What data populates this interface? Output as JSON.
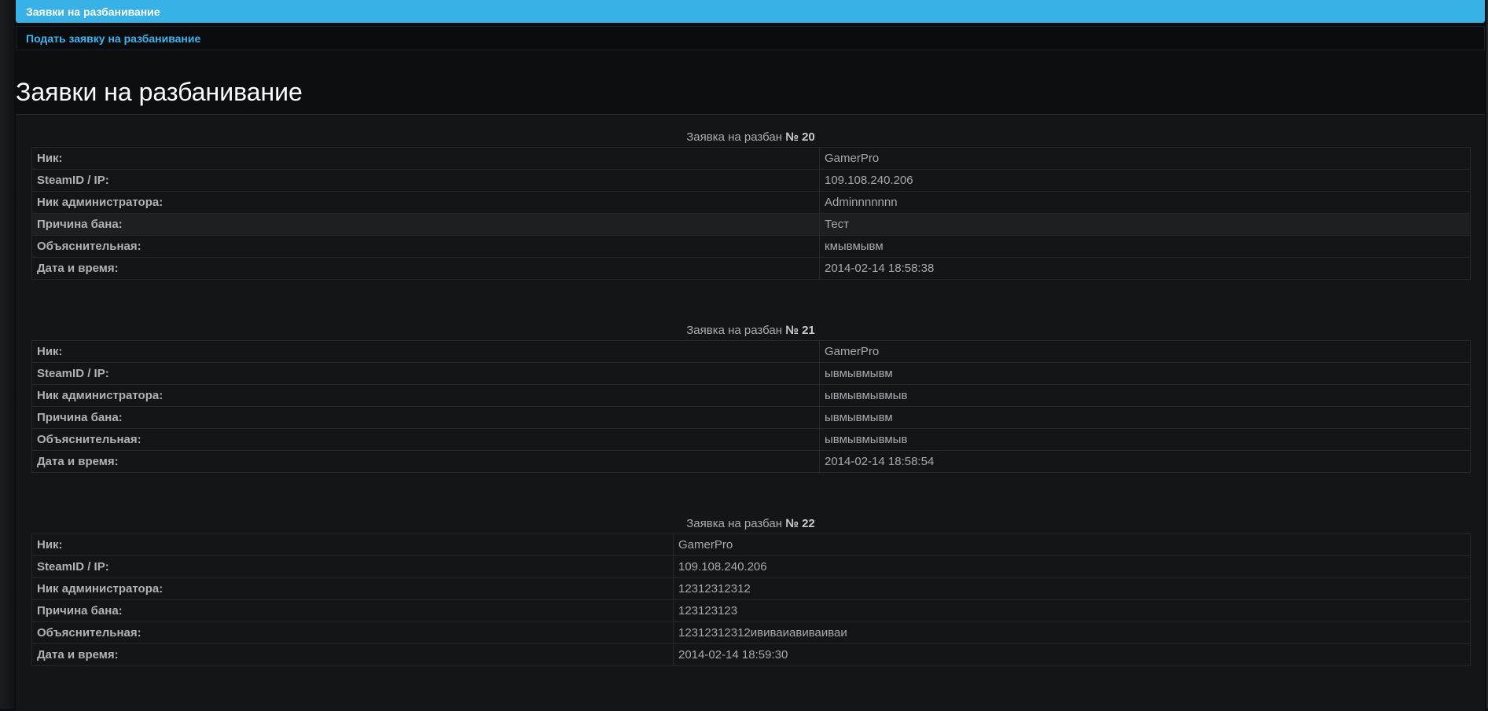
{
  "nav": {
    "active_label": "Заявки на разбанивание",
    "sub_label": "Подать заявку на разбанивание"
  },
  "page_title": "Заявки на разбанивание",
  "requests": [
    {
      "caption_prefix": "Заявка на разбан",
      "number": "№ 20",
      "rows": [
        {
          "label": "Ник:",
          "value": "GamerPro"
        },
        {
          "label": "SteamID / IP:",
          "value": "109.108.240.206"
        },
        {
          "label": "Ник администратора:",
          "value": "Adminnnnnnn"
        },
        {
          "label": "Причина бана:",
          "value": "Тест"
        },
        {
          "label": "Объяснительная:",
          "value": "кмывмывм"
        },
        {
          "label": "Дата и время:",
          "value": "2014-02-14 18:58:38"
        }
      ]
    },
    {
      "caption_prefix": "Заявка на разбан",
      "number": "№ 21",
      "rows": [
        {
          "label": "Ник:",
          "value": "GamerPro"
        },
        {
          "label": "SteamID / IP:",
          "value": "ывмывмывм"
        },
        {
          "label": "Ник администратора:",
          "value": "ывмывмывмыв"
        },
        {
          "label": "Причина бана:",
          "value": "ывмывмывм"
        },
        {
          "label": "Объяснительная:",
          "value": "ывмывмывмыв"
        },
        {
          "label": "Дата и время:",
          "value": "2014-02-14 18:58:54"
        }
      ]
    },
    {
      "caption_prefix": "Заявка на разбан",
      "number": "№ 22",
      "rows": [
        {
          "label": "Ник:",
          "value": "GamerPro"
        },
        {
          "label": "SteamID / IP:",
          "value": "109.108.240.206"
        },
        {
          "label": "Ник администратора:",
          "value": "12312312312"
        },
        {
          "label": "Причина бана:",
          "value": "123123123"
        },
        {
          "label": "Объяснительная:",
          "value": "12312312312ививаиавиваиваи"
        },
        {
          "label": "Дата и время:",
          "value": "2014-02-14 18:59:30"
        }
      ]
    }
  ]
}
